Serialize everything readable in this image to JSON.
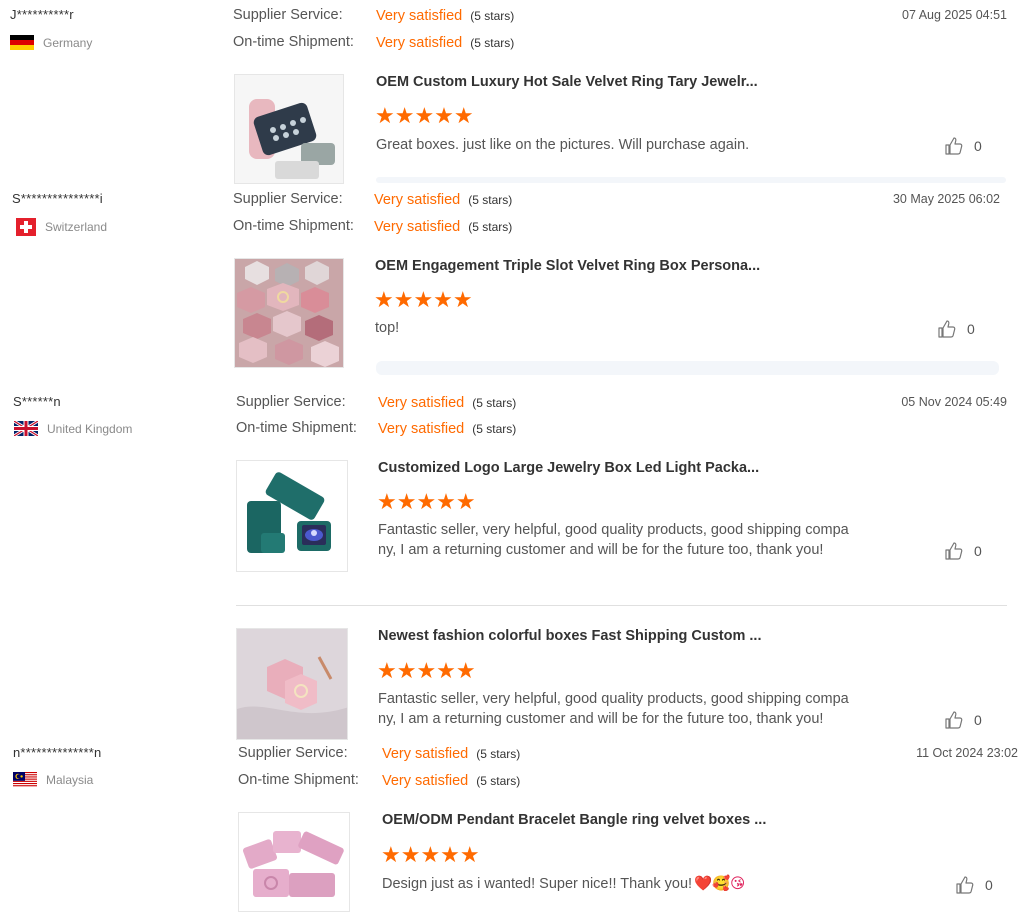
{
  "reviews": [
    {
      "buyer": "J**********r",
      "country": "Germany",
      "flag": "germany",
      "supplier_label": "Supplier Service:",
      "supplier_value": "Very satisfied",
      "supplier_stars": "(5 stars)",
      "shipment_label": "On-time Shipment:",
      "shipment_value": "Very satisfied",
      "shipment_stars": "(5 stars)",
      "date": "07 Aug 2025 04:51",
      "products": [
        {
          "title": "OEM Custom Luxury Hot Sale Velvet Ring Tary Jewelr...",
          "rating": 5,
          "comment": "Great boxes. just like on the pictures. Will purchase again.",
          "likes": "0"
        }
      ]
    },
    {
      "buyer": "S***************i",
      "country": "Switzerland",
      "flag": "switzerland",
      "supplier_label": "Supplier Service:",
      "supplier_value": "Very satisfied",
      "supplier_stars": "(5 stars)",
      "shipment_label": "On-time Shipment:",
      "shipment_value": "Very satisfied",
      "shipment_stars": "(5 stars)",
      "date": "30 May 2025 06:02",
      "products": [
        {
          "title": "OEM Engagement Triple Slot Velvet Ring Box Persona...",
          "rating": 5,
          "comment": "top!",
          "likes": "0"
        }
      ]
    },
    {
      "buyer": "S******n",
      "country": "United Kingdom",
      "flag": "uk",
      "supplier_label": "Supplier Service:",
      "supplier_value": "Very satisfied",
      "supplier_stars": "(5 stars)",
      "shipment_label": "On-time Shipment:",
      "shipment_value": "Very satisfied",
      "shipment_stars": "(5 stars)",
      "date": "05 Nov 2024 05:49",
      "products": [
        {
          "title": "Customized Logo Large Jewelry Box Led Light Packa...",
          "rating": 5,
          "comment_line1": "Fantastic seller, very helpful, good quality products, good shipping compa",
          "comment_line2": "ny, I am a returning customer and will be for the future too, thank you!",
          "likes": "0"
        },
        {
          "title": "Newest fashion colorful boxes Fast Shipping Custom ...",
          "rating": 5,
          "comment_line1": "Fantastic seller, very helpful, good quality products, good shipping compa",
          "comment_line2": "ny, I am a returning customer and will be for the future too, thank you!",
          "likes": "0"
        }
      ]
    },
    {
      "buyer": "n**************n",
      "country": "Malaysia",
      "flag": "malaysia",
      "supplier_label": "Supplier Service:",
      "supplier_value": "Very satisfied",
      "supplier_stars": "(5 stars)",
      "shipment_label": "On-time Shipment:",
      "shipment_value": "Very satisfied",
      "shipment_stars": "(5 stars)",
      "date": "11 Oct 2024 23:02",
      "products": [
        {
          "title": "OEM/ODM Pendant Bracelet Bangle ring velvet boxes ...",
          "rating": 5,
          "comment": "Design just as i wanted! Super nice!! Thank you!",
          "emoji": "❤️🥰😘",
          "likes": "0"
        }
      ]
    }
  ],
  "stars_glyph": "★★★★★",
  "icons": {
    "like": "thumbs-up-icon"
  },
  "colors": {
    "accent": "#ff6a00"
  }
}
